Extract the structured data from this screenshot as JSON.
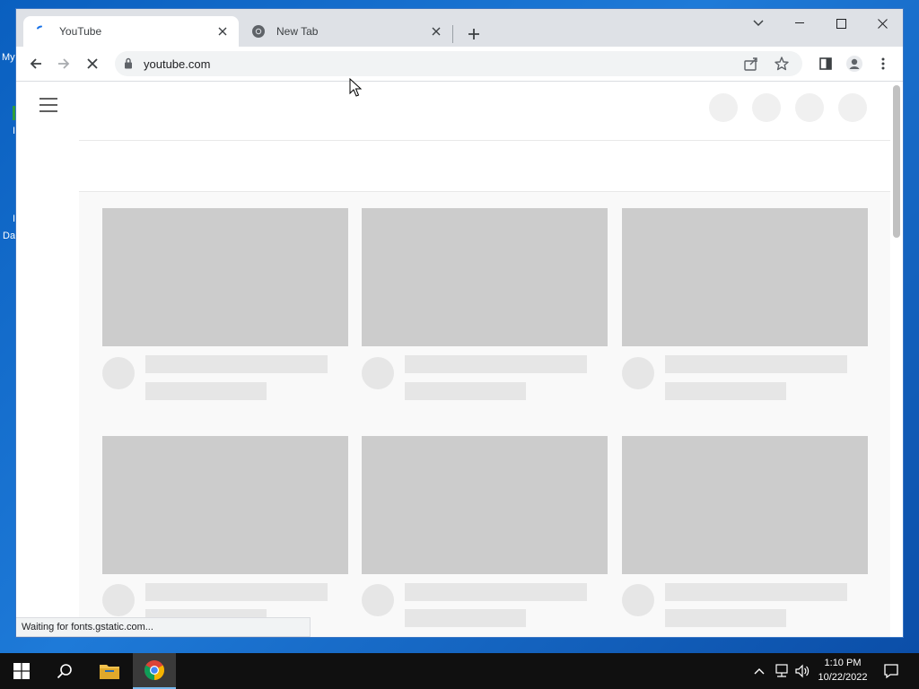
{
  "desktop": {
    "labels": [
      "My",
      "I",
      "I",
      "Da"
    ]
  },
  "browser": {
    "tabs": [
      {
        "title": "YouTube",
        "active": true
      },
      {
        "title": "New Tab",
        "active": false
      }
    ],
    "address": "youtube.com",
    "status_text": "Waiting for fonts.gstatic.com..."
  },
  "page": {
    "state": "loading skeleton",
    "card_rows": 2,
    "cards_per_row": 3
  },
  "taskbar": {
    "time": "1:10 PM",
    "date": "10/22/2022"
  },
  "colors": {
    "tab_strip": "#dee1e6",
    "skeleton_thumb": "#cccccc",
    "skeleton_line": "#e6e6e6",
    "taskbar": "#101010",
    "accent": "#1a73e8"
  }
}
